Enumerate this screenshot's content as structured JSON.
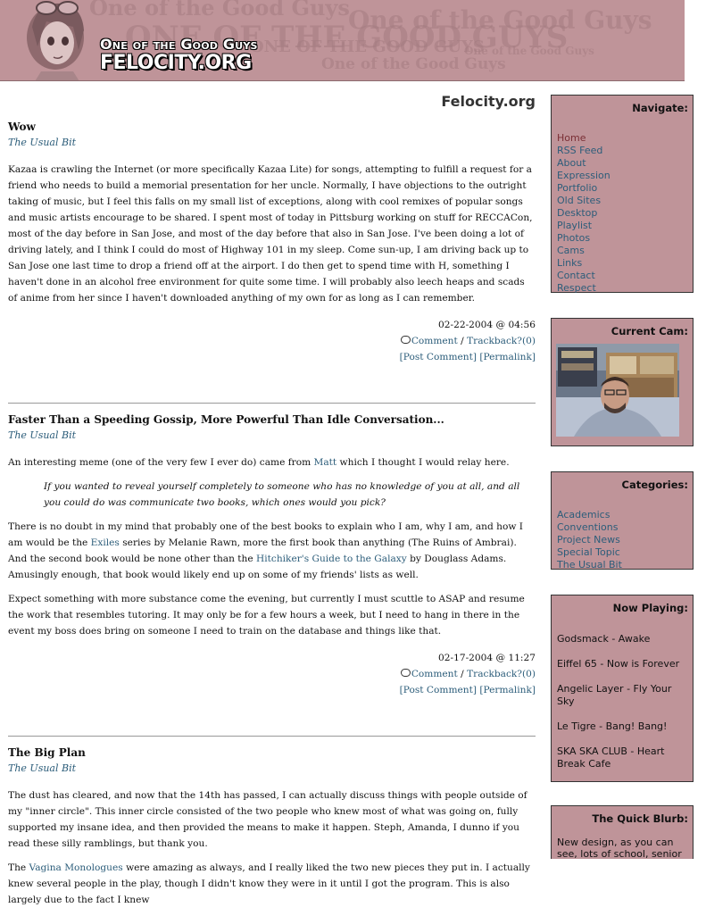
{
  "header": {
    "logo_tagline": "One of the Good Guys",
    "logo_name": "FELOCITY.ORG",
    "watermarks": [
      "One of the Good Guys",
      "One of the Good Guys",
      "ONE OF THE GOOD GUYS",
      "ONE OF THE GOOD GUYS",
      "One of the Good Guys",
      "One of the Good Guys"
    ]
  },
  "site_title": "Felocity.org",
  "posts": [
    {
      "title": "Wow",
      "category": "The Usual Bit",
      "paragraphs": [
        "Kazaa is crawling the Internet (or more specifically Kazaa Lite) for songs, attempting to fulfill a request for a friend who needs to build a memorial presentation for her uncle. Normally, I have objections to the outright taking of music, but I feel this falls on my small list of exceptions, along with cool remixes of popular songs and music artists encourage to be shared. I spent most of today in Pittsburg working on stuff for RECCACon, most of the day before in San Jose, and most of the day before that also in San Jose. I've been doing a lot of driving lately, and I think I could do most of Highway 101 in my sleep. Come sun-up, I am driving back up to San Jose one last time to drop a friend off at the airport. I do then get to spend time with H, something I haven't done in an alcohol free environment for quite some time. I will probably also leech heaps and scads of anime from her since I haven't downloaded anything of my own for as long as I can remember."
      ],
      "date": "02-22-2004 @ 04:56",
      "comment_label": "Comment",
      "trackback_label": "Trackback?(0)",
      "post_comment_label": "[Post Comment]",
      "permalink_label": "[Permalink]"
    },
    {
      "title": "Faster Than a Speeding Gossip, More Powerful Than Idle Conversation...",
      "category": "The Usual Bit",
      "p1_before": "An interesting meme (one of the very few I ever do) came from ",
      "p1_link": "Matt",
      "p1_after": " which I thought I would relay here.",
      "quote": "If you wanted to reveal yourself completely to someone who has no knowledge of you at all, and all you could do was communicate two books, which ones would you pick?",
      "p2_a": "There is no doubt in my mind that probably one of the best books to explain who I am, why I am, and how I am would be the ",
      "p2_link1": "Exiles",
      "p2_b": " series by Melanie Rawn, more the first book than anything (The Ruins of Ambrai). And the second book would be none other than the ",
      "p2_link2": "Hitchiker's Guide to the Galaxy",
      "p2_c": " by Douglass Adams. Amusingly enough, that book would likely end up on some of my friends' lists as well.",
      "p3": "Expect something with more substance come the evening, but currently I must scuttle to ASAP and resume the work that resembles tutoring. It may only be for a few hours a week, but I need to hang in there in the event my boss does bring on someone I need to train on the database and things like that.",
      "date": "02-17-2004 @ 11:27",
      "comment_label": "Comment",
      "trackback_label": "Trackback?(0)",
      "post_comment_label": "[Post Comment]",
      "permalink_label": "[Permalink]"
    },
    {
      "title": "The Big Plan",
      "category": "The Usual Bit",
      "p1": "The dust has cleared, and now that the 14th has passed, I can actually discuss things with people outside of my \"inner circle\". This inner circle consisted of the two people who knew most of what was going on, fully supported my insane idea, and then provided the means to make it happen. Steph, Amanda, I dunno if you read these silly ramblings, but thank you.",
      "p2_a": "The ",
      "p2_link": "Vagina Monologues",
      "p2_b": " were amazing as always, and I really liked the two new pieces they put in. I actually knew several people in the play, though I didn't know they were in it until I got the program. This is also largely due to the fact I knew"
    }
  ],
  "sidebar": {
    "navigate": {
      "heading": "Navigate:",
      "items": [
        "Home",
        "RSS Feed",
        "About",
        "Expression",
        "Portfolio",
        "Old Sites",
        "Desktop",
        "Playlist",
        "Photos",
        "Cams",
        "Links",
        "Contact",
        "Respect"
      ]
    },
    "current_cam": {
      "heading": "Current Cam:"
    },
    "categories": {
      "heading": "Categories:",
      "items": [
        "Academics",
        "Conventions",
        "Project News",
        "Special Topic",
        "The Usual Bit"
      ]
    },
    "now_playing": {
      "heading": "Now Playing:",
      "items": [
        "Godsmack - Awake",
        "Eiffel 65 - Now is Forever",
        "Angelic Layer - Fly Your Sky",
        "Le Tigre - Bang! Bang!",
        "SKA SKA CLUB - Heart Break Cafe"
      ]
    },
    "quick_blurb": {
      "heading": "The Quick Blurb:",
      "text": "New design, as you can see, lots of school, senior"
    }
  },
  "colors": {
    "header_bg": "#bf9499",
    "sidebar_bg": "#bf9499",
    "link": "#2c5d7a",
    "current_nav": "#7a2f35"
  }
}
